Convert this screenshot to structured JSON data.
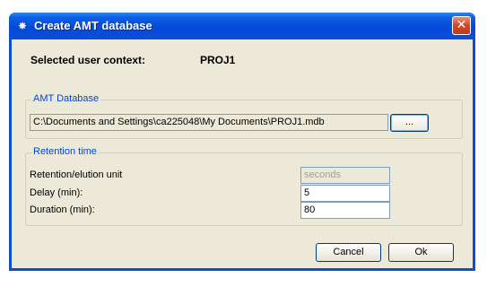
{
  "window": {
    "title": "Create AMT database",
    "app_icon": "star-burst-icon",
    "close_glyph": "✕"
  },
  "context": {
    "label": "Selected user context:",
    "value": "PROJ1"
  },
  "amt_database": {
    "group_title": "AMT Database",
    "path": "C:\\Documents and Settings\\ca225048\\My Documents\\PROJ1.mdb",
    "browse_label": "..."
  },
  "retention": {
    "group_title": "Retention time",
    "unit_label": "Retention/elution unit",
    "unit_value": "seconds",
    "delay_label": "Delay (min):",
    "delay_value": "5",
    "duration_label": "Duration (min):",
    "duration_value": "80"
  },
  "buttons": {
    "cancel": "Cancel",
    "ok": "Ok"
  },
  "colors": {
    "titlebar": "#0549d8",
    "group_title": "#0046d5",
    "dialog_bg": "#ece9d8",
    "close": "#d0462a"
  }
}
